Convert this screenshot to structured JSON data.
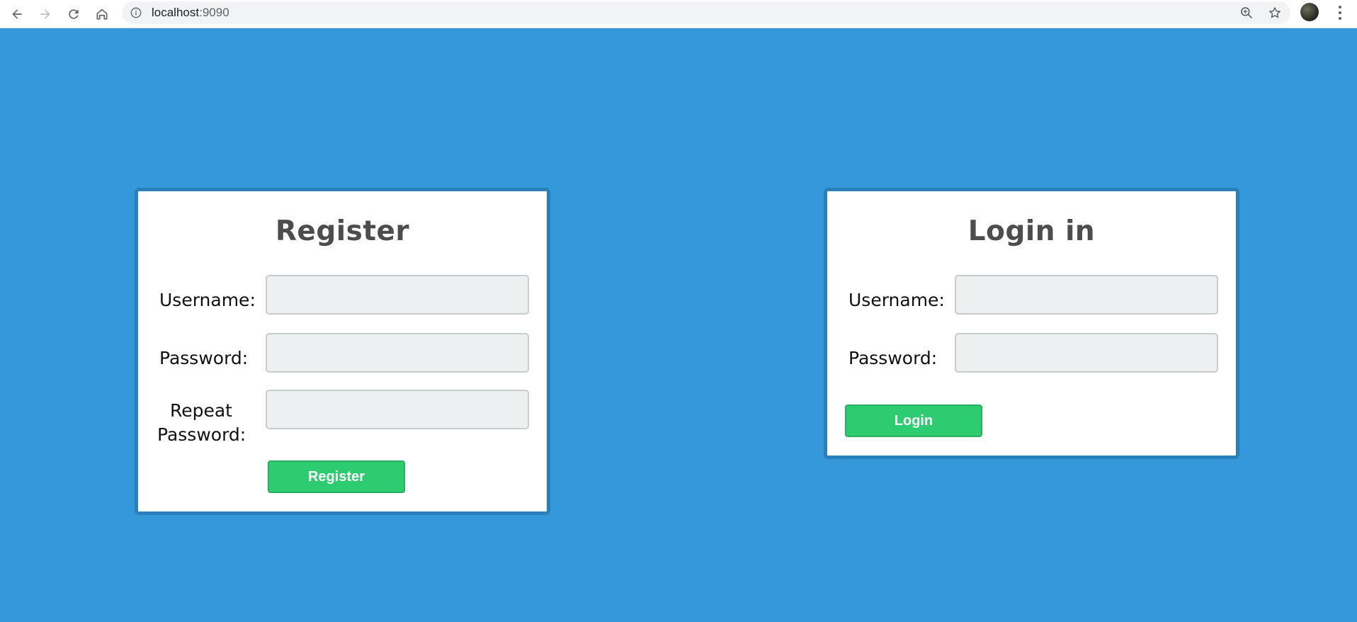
{
  "browser": {
    "url_host": "localhost",
    "url_port": ":9090",
    "icons": {
      "back": "arrow-left-icon",
      "forward": "arrow-right-icon",
      "reload": "reload-icon",
      "home": "home-icon",
      "info": "info-icon",
      "zoom": "zoom-icon",
      "bookmark": "star-icon",
      "profile": "avatar",
      "menu": "more-vert-icon"
    }
  },
  "register": {
    "title": "Register",
    "username_label": "Username:",
    "password_label": "Password:",
    "repeat_label_line1": "Repeat",
    "repeat_label_line2": "Password:",
    "username_value": "",
    "password_value": "",
    "repeat_value": "",
    "button_label": "Register"
  },
  "login": {
    "title": "Login in",
    "username_label": "Username:",
    "password_label": "Password:",
    "username_value": "",
    "password_value": "",
    "button_label": "Login"
  },
  "colors": {
    "page_background": "#3598db",
    "card_border": "#2a80b9",
    "button_green": "#2ecc71",
    "input_background": "#ecf0f1"
  }
}
